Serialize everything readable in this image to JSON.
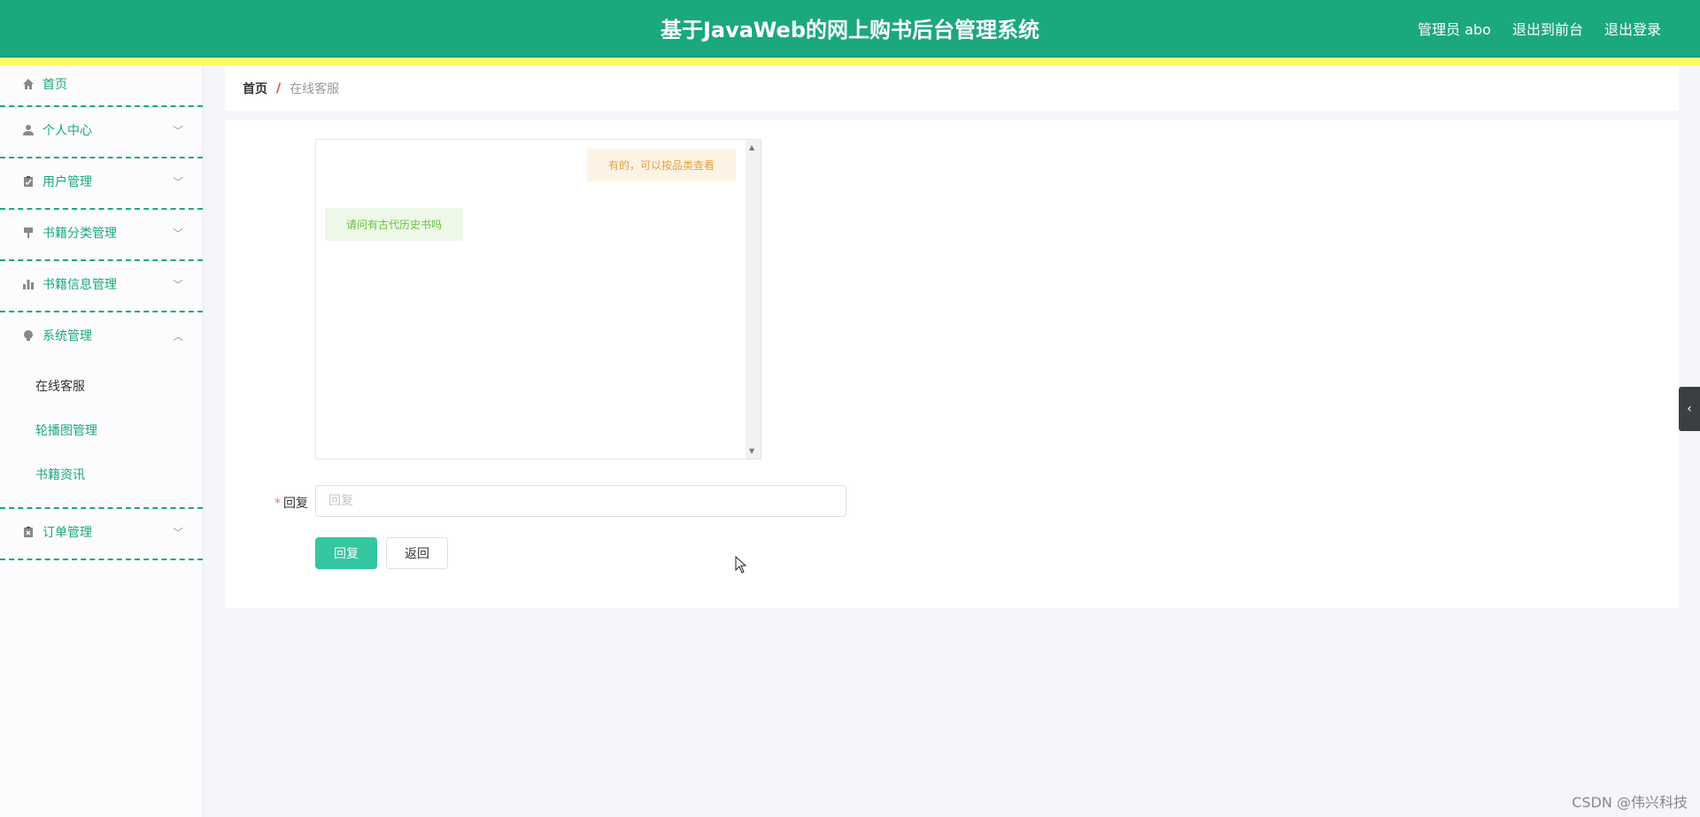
{
  "header": {
    "title": "基于JavaWeb的网上购书后台管理系统",
    "user_label": "管理员 abo",
    "front_link": "退出到前台",
    "logout_link": "退出登录"
  },
  "sidebar": {
    "items": [
      {
        "label": "首页",
        "icon": "home-icon"
      },
      {
        "label": "个人中心",
        "icon": "user-icon"
      },
      {
        "label": "用户管理",
        "icon": "clipboard-icon"
      },
      {
        "label": "书籍分类管理",
        "icon": "brush-icon"
      },
      {
        "label": "书籍信息管理",
        "icon": "bar-chart-icon"
      },
      {
        "label": "系统管理",
        "icon": "bulb-icon"
      },
      {
        "label": "订单管理",
        "icon": "document-icon"
      }
    ],
    "system_submenu": [
      "在线客服",
      "轮播图管理",
      "书籍资讯"
    ]
  },
  "breadcrumb": {
    "home": "首页",
    "separator": "/",
    "current": "在线客服"
  },
  "chat": {
    "messages": [
      {
        "side": "right",
        "text": "有的，可以按品类查看"
      },
      {
        "side": "left",
        "text": "请问有古代历史书吗"
      }
    ]
  },
  "form": {
    "label": "回复",
    "required_mark": "*",
    "input_value": "",
    "placeholder": "回复",
    "submit_label": "回复",
    "back_label": "返回"
  },
  "watermark": "CSDN @伟兴科技",
  "colors": {
    "primary": "#1ba87c",
    "accent_bar": "#fffa66",
    "button": "#33c6a1"
  }
}
